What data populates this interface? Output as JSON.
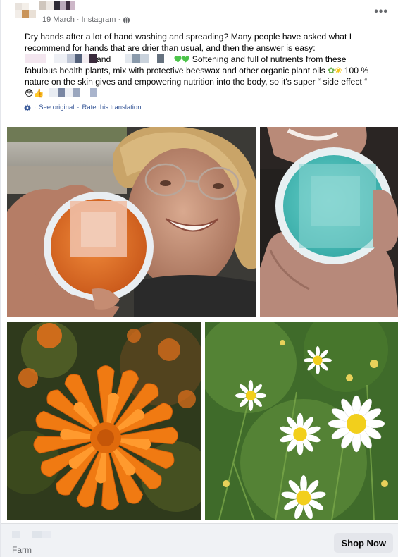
{
  "post": {
    "meta_date": "19 March",
    "meta_sep": "·",
    "meta_source": "Instagram",
    "meta_sep2": "·",
    "more_icon": "more-horizontal-icon",
    "lines": {
      "line1": "Dry hands after a lot of hand washing and spreading? Many people have asked what I",
      "line2": "recommend for hands that are drier than usual, and then the answer is easy:",
      "line3_and": "and",
      "line3_rest": " Softening and full of nutrients from these",
      "line4_a": "fabulous health plants, mix with protective beeswax and other organic plant oils ",
      "line4_b": " 100 %",
      "line5_a": "nature on the skin gives and empowering nutrition into the body, so it's super “ side effect “",
      "line6_emoji": "😳👍"
    },
    "see_original": "See original",
    "translation_sep": "·",
    "rate_translation": "Rate this translation"
  },
  "footer": {
    "label": "Farm",
    "shop_button": "Shop Now"
  },
  "colors": {
    "link": "#385898",
    "meta": "#65676b",
    "footer_bg": "#f0f2f5",
    "button_bg": "#e4e6eb"
  }
}
